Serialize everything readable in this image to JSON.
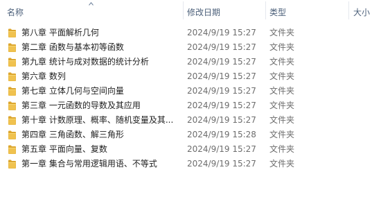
{
  "columns": {
    "name": "名称",
    "modified": "修改日期",
    "type": "类型",
    "size": "大小"
  },
  "sort": {
    "column": "name",
    "icon": "sort-up-arrow-icon"
  },
  "folder_icon": {
    "name": "folder-icon",
    "color": "#e8b33c"
  },
  "items": [
    {
      "name": "第八章 平面解析几何",
      "modified": "2024/9/19 15:27",
      "type": "文件夹"
    },
    {
      "name": "第二章 函数与基本初等函数",
      "modified": "2024/9/19 15:27",
      "type": "文件夹"
    },
    {
      "name": "第九章 统计与成对数据的统计分析",
      "modified": "2024/9/19 15:27",
      "type": "文件夹"
    },
    {
      "name": "第六章 数列",
      "modified": "2024/9/19 15:27",
      "type": "文件夹"
    },
    {
      "name": "第七章 立体几何与空间向量",
      "modified": "2024/9/19 15:27",
      "type": "文件夹"
    },
    {
      "name": "第三章 一元函数的导数及其应用",
      "modified": "2024/9/19 15:27",
      "type": "文件夹"
    },
    {
      "name": "第十章 计数原理、概率、随机变量及其...",
      "modified": "2024/9/19 15:27",
      "type": "文件夹"
    },
    {
      "name": "第四章 三角函数、解三角形",
      "modified": "2024/9/19 15:28",
      "type": "文件夹"
    },
    {
      "name": "第五章 平面向量、复数",
      "modified": "2024/9/19 15:27",
      "type": "文件夹"
    },
    {
      "name": "第一章 集合与常用逻辑用语、不等式",
      "modified": "2024/9/19 15:27",
      "type": "文件夹"
    }
  ]
}
